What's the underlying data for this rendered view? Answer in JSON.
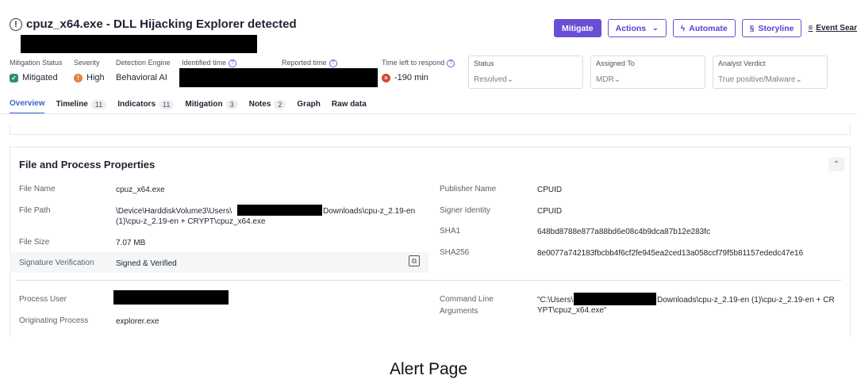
{
  "header": {
    "title": "cpuz_x64.exe - DLL Hijacking Explorer detected",
    "buttons": {
      "mitigate": "Mitigate",
      "actions": "Actions",
      "automate": "Automate",
      "storyline": "Storyline",
      "event_search": "Event Sear"
    }
  },
  "meta": {
    "mitigation_status_label": "Mitigation Status",
    "mitigation_status_value": "Mitigated",
    "severity_label": "Severity",
    "severity_value": "High",
    "detection_engine_label": "Detection Engine",
    "detection_engine_value": "Behavioral AI",
    "identified_time_label": "Identified time",
    "reported_time_label": "Reported time",
    "time_left_label": "Time left to respond",
    "time_left_value": "-190 min"
  },
  "selects": {
    "status_label": "Status",
    "status_value": "Resolved",
    "assigned_label": "Assigned To",
    "assigned_value": "MDR",
    "verdict_label": "Analyst Verdict",
    "verdict_value": "True positive/Malware"
  },
  "tabs": [
    {
      "label": "Overview",
      "count": ""
    },
    {
      "label": "Timeline",
      "count": "11"
    },
    {
      "label": "Indicators",
      "count": "11"
    },
    {
      "label": "Mitigation",
      "count": "3"
    },
    {
      "label": "Notes",
      "count": "2"
    },
    {
      "label": "Graph",
      "count": ""
    },
    {
      "label": "Raw data",
      "count": ""
    }
  ],
  "card": {
    "title": "File and Process Properties",
    "file_name_label": "File Name",
    "file_name_value": "cpuz_x64.exe",
    "file_path_label": "File Path",
    "file_path_part1": "\\Device\\HarddiskVolume3\\Users\\",
    "file_path_part2": "Downloads\\cpu-z_2.19-en",
    "file_path_line2": "(1)\\cpu-z_2.19-en + CRYPT\\cpuz_x64.exe",
    "file_size_label": "File Size",
    "file_size_value": "7.07 MB",
    "sig_label": "Signature Verification",
    "sig_value": "Signed & Verified",
    "publisher_label": "Publisher Name",
    "publisher_value": "CPUID",
    "signer_label": "Signer Identity",
    "signer_value": "CPUID",
    "sha1_label": "SHA1",
    "sha1_value": "648bd8788e877a88bd6e08c4b9dca87b12e283fc",
    "sha256_label": "SHA256",
    "sha256_value": "8e0077a742183fbcbb4f6cf2fe945ea2ced13a058ccf79f5b81157ededc47e16",
    "process_user_label": "Process User",
    "orig_process_label": "Originating Process",
    "orig_process_value": "explorer.exe",
    "cmd_label_1": "Command Line",
    "cmd_label_2": "Arguments",
    "cmd_part1": "\"C:\\Users\\",
    "cmd_part2": "Downloads\\cpu-z_2.19-en (1)\\cpu-z_2.19-en + CR",
    "cmd_line2": "YPT\\cpuz_x64.exe\""
  },
  "caption": "Alert Page",
  "colors": {
    "accent": "#6a4fd6",
    "tab_active": "#3e63c8",
    "mitigated": "#2a8f7a",
    "high": "#e8803a",
    "time_left": "#d9443a"
  }
}
